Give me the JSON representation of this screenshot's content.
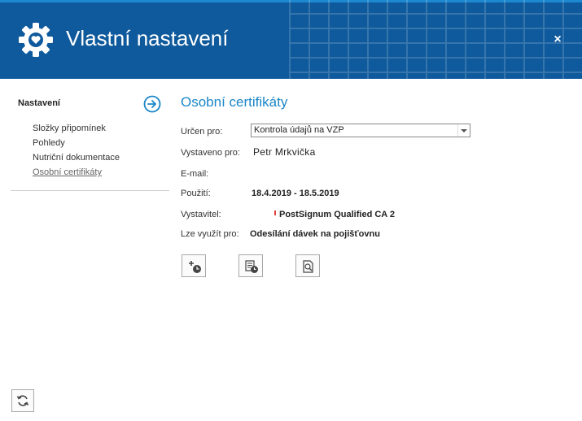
{
  "window": {
    "title": "Vlastní nastavení",
    "close_label": "×",
    "accent_color": "#0f5a9c"
  },
  "sidebar": {
    "heading": "Nastavení",
    "items": [
      {
        "label": "Složky připomínek"
      },
      {
        "label": "Pohledy"
      },
      {
        "label": "Nutriční dokumentace"
      },
      {
        "label": "Osobní certifikáty",
        "active": true
      }
    ]
  },
  "main": {
    "title": "Osobní certifikáty",
    "fields": {
      "urcen_pro": {
        "label": "Určen pro:",
        "value": "Kontrola údajů na VZP"
      },
      "vystaveno_pro": {
        "label": "Vystaveno pro:",
        "value": "Petr Mrkvička"
      },
      "email": {
        "label": "E-mail:",
        "value": ""
      },
      "pouziti": {
        "label": "Použití:",
        "value": "18.4.2019 - 18.5.2019"
      },
      "vystavitel": {
        "label": "Vystavitel:",
        "value": "PostSignum Qualified CA 2"
      },
      "lze_vyuzit_pro": {
        "label": "Lze využít pro:",
        "value": "Odesílání dávek na pojišťovnu"
      }
    },
    "toolbar": {
      "buttons": [
        {
          "icon": "add-certificate-icon"
        },
        {
          "icon": "certificate-history-icon"
        },
        {
          "icon": "preview-certificate-icon"
        }
      ]
    }
  },
  "footer": {
    "refresh_icon": "refresh-icon"
  },
  "colors": {
    "link_blue": "#1a86c8",
    "header_blue": "#0f5a9c"
  }
}
